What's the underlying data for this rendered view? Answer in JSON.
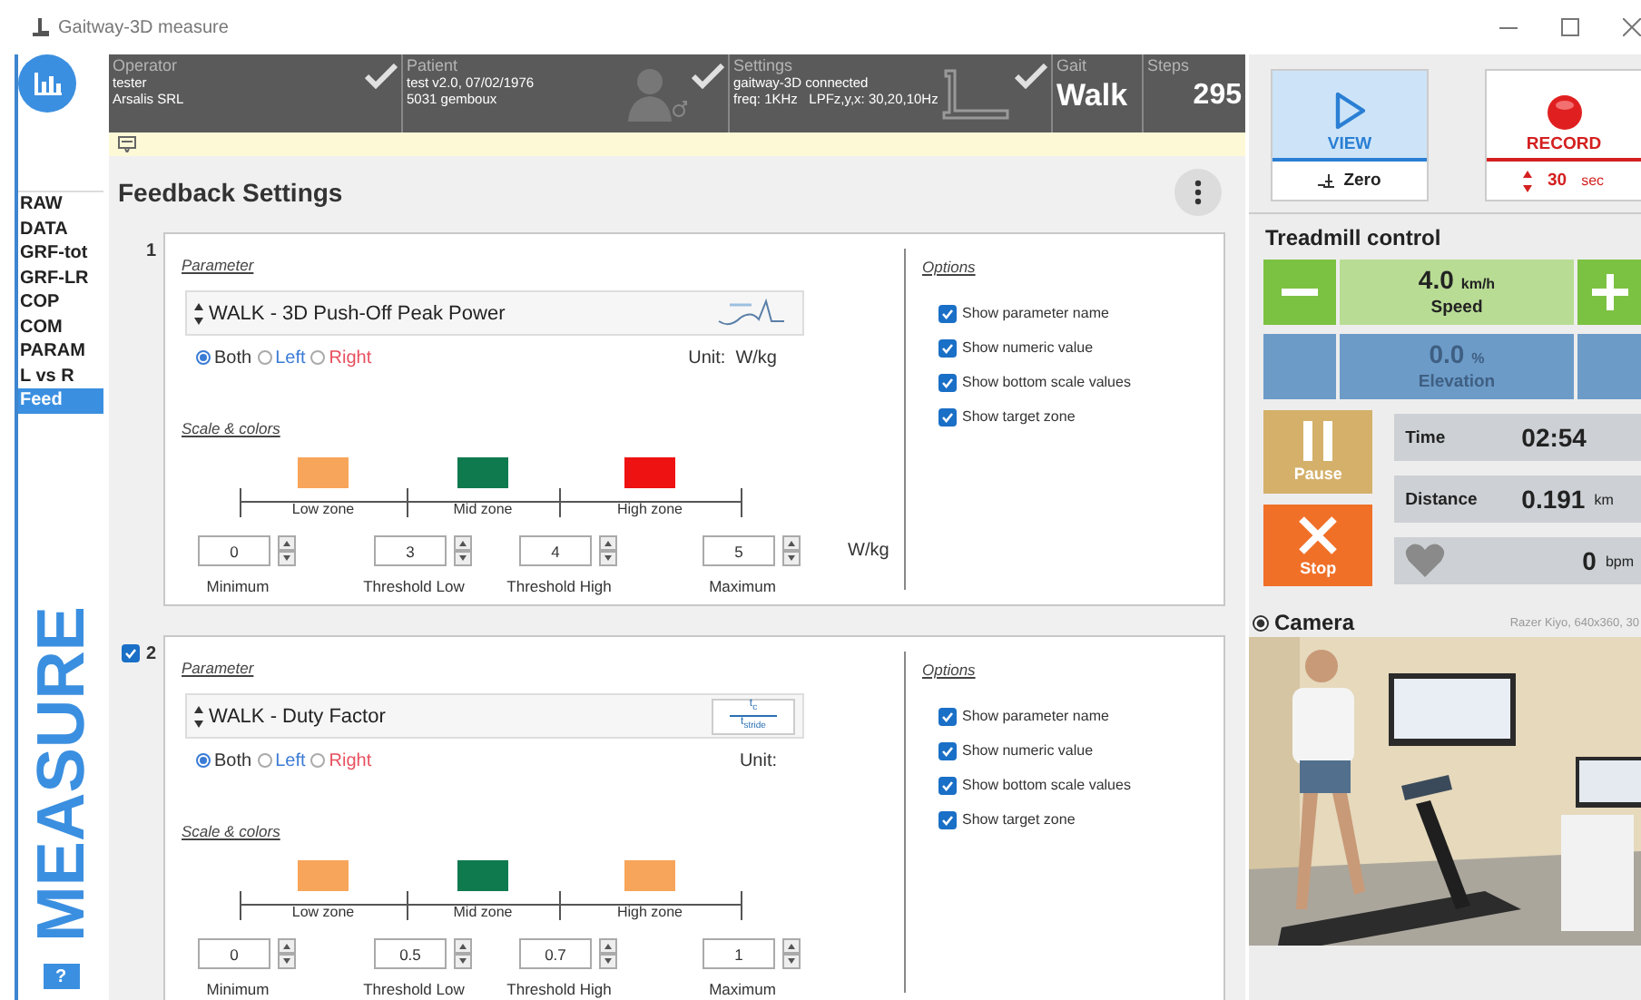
{
  "window": {
    "title": "Gaitway-3D measure"
  },
  "sidebar": {
    "items": [
      {
        "label": "RAW",
        "selected": false
      },
      {
        "label": "DATA",
        "selected": false
      },
      {
        "label": "GRF-tot",
        "selected": false
      },
      {
        "label": "GRF-LR",
        "selected": false
      },
      {
        "label": "COP",
        "selected": false
      },
      {
        "label": "COM",
        "selected": false
      },
      {
        "label": "PARAM",
        "selected": false
      },
      {
        "label": "L vs R",
        "selected": false
      },
      {
        "label": "Feed",
        "selected": true
      }
    ],
    "mode_label": "MEASURE",
    "help_button": "?"
  },
  "header": {
    "cells": [
      {
        "kind": "operator",
        "label": "Operator",
        "lines": [
          "tester",
          "Arsalis SRL"
        ],
        "checked": true
      },
      {
        "kind": "patient",
        "label": "Patient",
        "lines": [
          "test v2.0, 07/02/1976",
          "5031 gemboux"
        ],
        "checked": true
      },
      {
        "kind": "settings",
        "label": "Settings",
        "lines": [
          "gaitway-3D connected",
          "freq: 1KHz   LPFz,y,x: 30,20,10Hz"
        ],
        "checked": true
      },
      {
        "kind": "gait",
        "label": "Gait",
        "value": "Walk"
      },
      {
        "kind": "steps",
        "label": "Steps",
        "value": "295"
      }
    ]
  },
  "feedback": {
    "title": "Feedback Settings",
    "cards": [
      {
        "number": "1",
        "parameter_label": "Parameter",
        "parameter": "WALK - 3D Push-Off Peak Power",
        "thumbnail": {
          "kind": "graph"
        },
        "sides": [
          {
            "label": "Both",
            "selected": true,
            "color": "#333333"
          },
          {
            "label": "Left",
            "selected": false,
            "color": "#3a7bd5"
          },
          {
            "label": "Right",
            "selected": false,
            "color": "#e8505f"
          }
        ],
        "unit_label": "Unit:",
        "unit": "W/kg",
        "scale_label": "Scale & colors",
        "zones": [
          {
            "label": "Low zone",
            "color": "#f7a55a"
          },
          {
            "label": "Mid zone",
            "color": "#107a4f"
          },
          {
            "label": "High zone",
            "color": "#ee1212"
          }
        ],
        "fields": [
          {
            "label": "Minimum",
            "value": "0"
          },
          {
            "label": "Threshold Low",
            "value": "3"
          },
          {
            "label": "Threshold High",
            "value": "4"
          },
          {
            "label": "Maximum",
            "value": "5"
          }
        ],
        "scale_unit": "W/kg",
        "options_label": "Options",
        "options": [
          {
            "label": "Show parameter name",
            "checked": true
          },
          {
            "label": "Show numeric value",
            "checked": true
          },
          {
            "label": "Show bottom scale values",
            "checked": true
          },
          {
            "label": "Show target zone",
            "checked": true
          }
        ]
      },
      {
        "number": "2",
        "checked": true,
        "parameter_label": "Parameter",
        "parameter": "WALK - Duty Factor",
        "thumbnail": {
          "kind": "formula",
          "numerator": "t$_{c}$",
          "denominator": "t$_{stride}$"
        },
        "sides": [
          {
            "label": "Both",
            "selected": true,
            "color": "#333333"
          },
          {
            "label": "Left",
            "selected": false,
            "color": "#3a7bd5"
          },
          {
            "label": "Right",
            "selected": false,
            "color": "#e8505f"
          }
        ],
        "unit_label": "Unit:",
        "scale_label": "Scale & colors",
        "zones": [
          {
            "label": "Low zone",
            "color": "#f7a55a"
          },
          {
            "label": "Mid zone",
            "color": "#107a4f"
          },
          {
            "label": "High zone",
            "color": "#f7a55a"
          }
        ],
        "fields": [
          {
            "label": "Minimum",
            "value": "0"
          },
          {
            "label": "Threshold Low",
            "value": "0.5"
          },
          {
            "label": "Threshold High",
            "value": "0.7"
          },
          {
            "label": "Maximum",
            "value": "1"
          }
        ],
        "options_label": "Options",
        "options": [
          {
            "label": "Show parameter name",
            "checked": true
          },
          {
            "label": "Show numeric value",
            "checked": true
          },
          {
            "label": "Show bottom scale values",
            "checked": true
          },
          {
            "label": "Show target zone",
            "checked": true
          }
        ]
      }
    ]
  },
  "capture": {
    "modes": [
      {
        "kind": "view",
        "label": "VIEW",
        "selected": true,
        "action": "Zero"
      },
      {
        "kind": "record",
        "label": "RECORD",
        "selected": false,
        "duration": "30",
        "duration_unit": "sec"
      }
    ]
  },
  "treadmill": {
    "title": "Treadmill control",
    "speed": {
      "value": "4.0",
      "unit": "km/h",
      "label": "Speed"
    },
    "elevation": {
      "value": "0.0",
      "unit": "%",
      "label": "Elevation"
    },
    "pause": "Pause",
    "stop": "Stop",
    "time": {
      "label": "Time",
      "value": "02:54"
    },
    "distance": {
      "label": "Distance",
      "value": "0.191",
      "unit": "km"
    },
    "heart_rate": {
      "value": "0",
      "unit": "bpm"
    }
  },
  "camera": {
    "title": "Camera",
    "selected": true,
    "info": "Razer Kiyo, 640x360, 30"
  }
}
